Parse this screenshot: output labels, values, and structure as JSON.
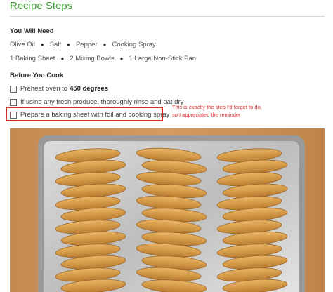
{
  "page": {
    "title": "Recipe Steps"
  },
  "you_will_need": {
    "heading": "You Will Need",
    "ingredients": [
      "Olive Oil",
      "Salt",
      "Pepper",
      "Cooking Spray"
    ],
    "tools": [
      "1 Baking Sheet",
      "2 Mixing Bowls",
      "1 Large Non-Stick Pan"
    ]
  },
  "before_you_cook": {
    "heading": "Before You Cook",
    "steps": [
      {
        "text": "Preheat oven to",
        "bold": "450 degrees",
        "checked": false
      },
      {
        "text": "If using any fresh produce, thoroughly rinse and pat dry",
        "checked": false
      },
      {
        "text": "Prepare a baking sheet with foil and cooking spray",
        "checked": false
      }
    ]
  },
  "annotation": {
    "line1": "This is exactly the step I'd forget to do,",
    "line2": "so I appreciated the reminder",
    "color": "#d92a2a"
  },
  "photo": {
    "subject": "potato-wedges-on-foil-lined-baking-sheet"
  },
  "colors": {
    "title_green": "#3f9c35",
    "highlight_red": "#d92a2a"
  }
}
